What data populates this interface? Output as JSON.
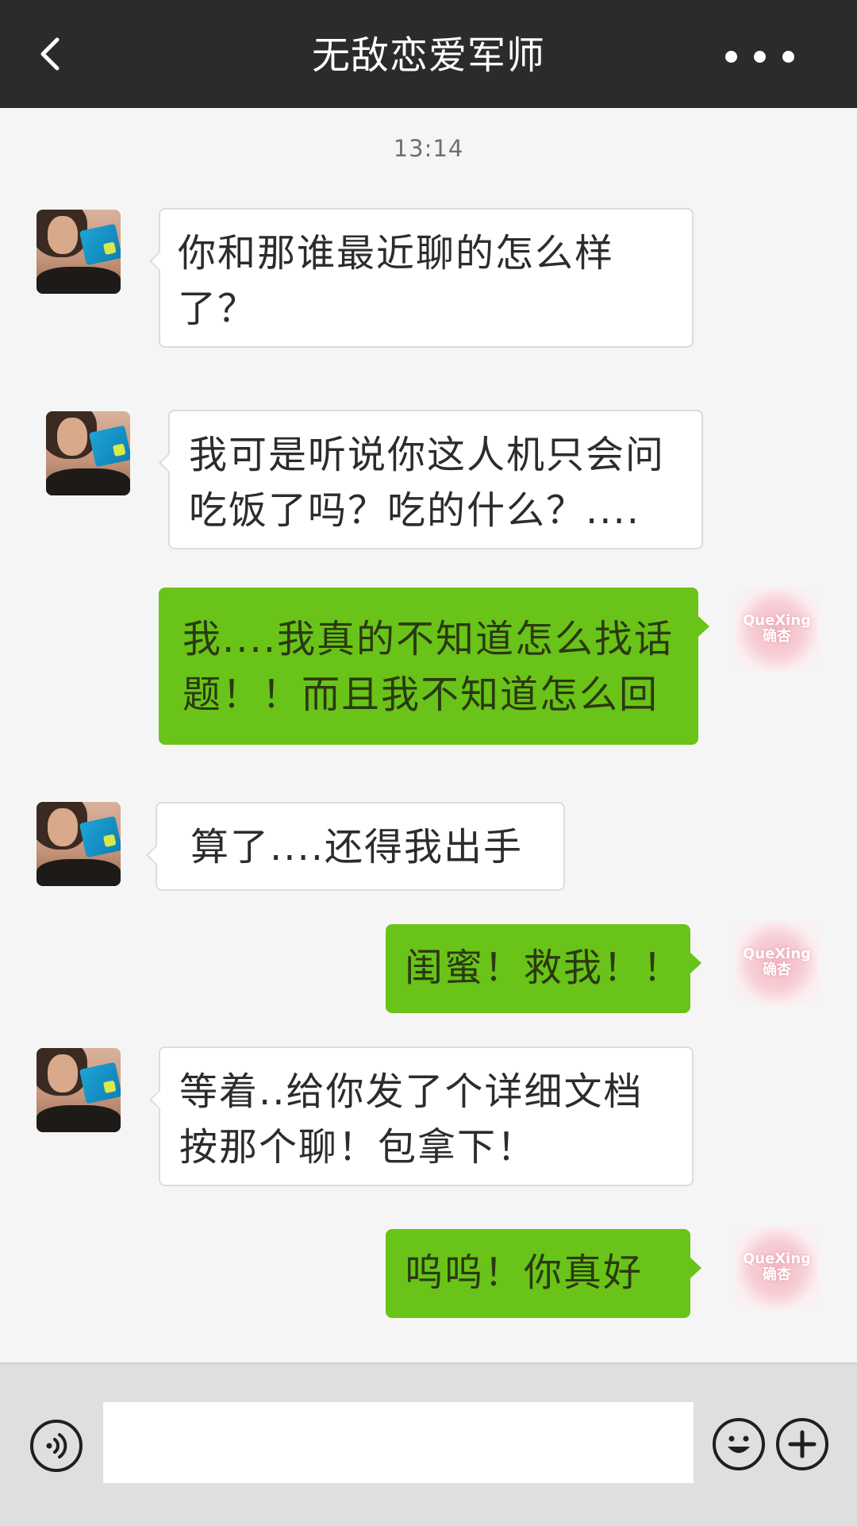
{
  "header": {
    "title": "无敌恋爱军师"
  },
  "timestamp": "13:14",
  "avatars": {
    "me_logo": {
      "line1": "QueXing",
      "line2": "确杏"
    }
  },
  "messages": [
    {
      "side": "left",
      "text": "你和那谁最近聊的怎么样了？"
    },
    {
      "side": "left",
      "text": "我可是听说你这人机只会问吃饭了吗？吃的什么？...."
    },
    {
      "side": "right",
      "text": "我....我真的不知道怎么找话题！！而且我不知道怎么回"
    },
    {
      "side": "left",
      "text": "算了....还得我出手"
    },
    {
      "side": "right",
      "text": "闺蜜！救我！！"
    },
    {
      "side": "left",
      "text": "等着..给你发了个详细文档按那个聊！包拿下！"
    },
    {
      "side": "right",
      "text": "呜呜！你真好"
    }
  ],
  "input": {
    "value": ""
  },
  "colors": {
    "header_bg": "#2b2b2b",
    "chat_bg": "#f5f5f5",
    "sent_bubble": "#6ac318",
    "received_bubble": "#ffffff"
  }
}
